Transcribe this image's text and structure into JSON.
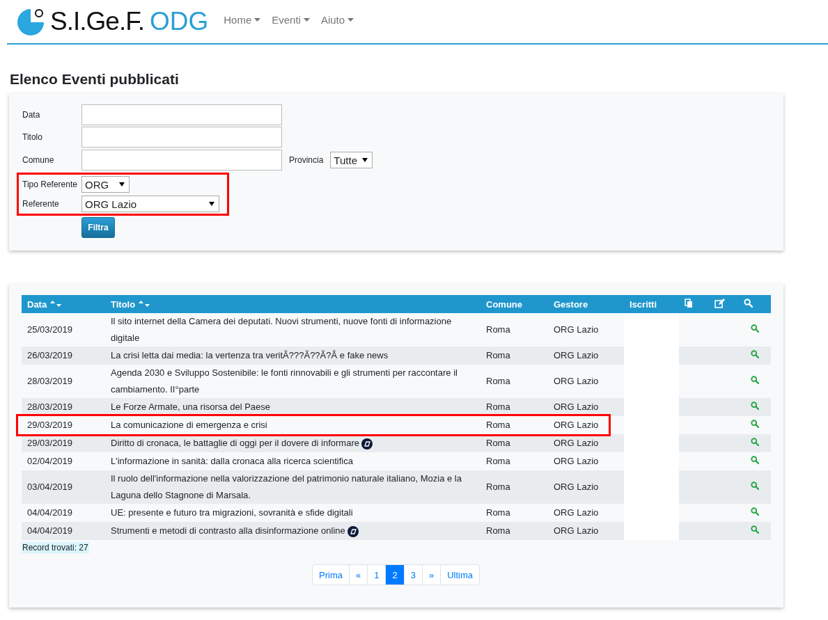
{
  "brand": {
    "name": "S.I.Ge.F.",
    "suffix": "ODG"
  },
  "nav": [
    {
      "label": "Home"
    },
    {
      "label": "Eventi"
    },
    {
      "label": "Aiuto"
    }
  ],
  "page_title": "Elenco Eventi pubblicati",
  "filter": {
    "fields": [
      {
        "kind": "input",
        "label": "Data",
        "highlighted": false
      },
      {
        "kind": "input",
        "label": "Titolo",
        "highlighted": false
      },
      {
        "kind": "input_with_select",
        "label": "Comune",
        "extra_label": "Provincia",
        "extra_value": "Tutte",
        "highlighted": false
      },
      {
        "kind": "select_small",
        "label": "Tipo Referente",
        "value": "ORG",
        "highlighted": true
      },
      {
        "kind": "select",
        "label": "Referente",
        "value": "ORG Lazio",
        "highlighted": true
      }
    ],
    "button": "Filtra"
  },
  "table": {
    "columns": [
      {
        "kind": "sort",
        "label": "Data"
      },
      {
        "kind": "sort",
        "label": "Titolo"
      },
      {
        "kind": "text",
        "label": "Comune"
      },
      {
        "kind": "text",
        "label": "Gestore"
      },
      {
        "kind": "text",
        "label": "Iscritti"
      },
      {
        "kind": "copy-icon"
      },
      {
        "kind": "edit-icon"
      },
      {
        "kind": "search-icon"
      }
    ],
    "rows": [
      {
        "data": "25/03/2019",
        "titolo": "Il sito internet della Camera dei deputati. Nuovi strumenti, nuove fonti di informazione digitale",
        "badge": false,
        "comune": "Roma",
        "gestore": "ORG Lazio",
        "highlighted": false
      },
      {
        "data": "26/03/2019",
        "titolo": "La crisi letta dai media: la vertenza tra veritÃ???Ã??Ã?Â  e fake news",
        "badge": false,
        "comune": "Roma",
        "gestore": "ORG Lazio",
        "highlighted": false
      },
      {
        "data": "28/03/2019",
        "titolo": "Agenda 2030 e Sviluppo Sostenibile: le fonti rinnovabili e gli strumenti per raccontare il cambiamento. II°parte",
        "badge": false,
        "comune": "Roma",
        "gestore": "ORG Lazio",
        "highlighted": false
      },
      {
        "data": "28/03/2019",
        "titolo": "Le Forze Armate, una risorsa del Paese",
        "badge": false,
        "comune": "Roma",
        "gestore": "ORG Lazio",
        "highlighted": false
      },
      {
        "data": "29/03/2019",
        "titolo": "La comunicazione di emergenza e crisi",
        "badge": false,
        "comune": "Roma",
        "gestore": "ORG Lazio",
        "highlighted": true
      },
      {
        "data": "29/03/2019",
        "titolo": "Diritto di cronaca, le battaglie di oggi per il dovere di informare",
        "badge": true,
        "comune": "Roma",
        "gestore": "ORG Lazio",
        "highlighted": false
      },
      {
        "data": "02/04/2019",
        "titolo": "L'informazione in sanità: dalla cronaca alla ricerca scientifica",
        "badge": false,
        "comune": "Roma",
        "gestore": "ORG Lazio",
        "highlighted": false
      },
      {
        "data": "03/04/2019",
        "titolo": "Il ruolo dell'informazione nella valorizzazione del patrimonio naturale italiano, Mozia e la Laguna dello Stagnone di Marsala.",
        "badge": false,
        "comune": "Roma",
        "gestore": "ORG Lazio",
        "highlighted": false
      },
      {
        "data": "04/04/2019",
        "titolo": "UE: presente e futuro tra migrazioni, sovranità e sfide digitali",
        "badge": false,
        "comune": "Roma",
        "gestore": "ORG Lazio",
        "highlighted": false
      },
      {
        "data": "04/04/2019",
        "titolo": "Strumenti e metodi di contrasto alla disinformazione online",
        "badge": true,
        "comune": "Roma",
        "gestore": "ORG Lazio",
        "highlighted": false
      }
    ],
    "record_count": "Record trovati: 27"
  },
  "pagination": [
    {
      "label": "Prima",
      "selected": false
    },
    {
      "label": "«",
      "selected": false
    },
    {
      "label": "1",
      "selected": false
    },
    {
      "label": "2",
      "selected": true
    },
    {
      "label": "3",
      "selected": false
    },
    {
      "label": "»",
      "selected": false
    },
    {
      "label": "Ultima",
      "selected": false
    }
  ]
}
